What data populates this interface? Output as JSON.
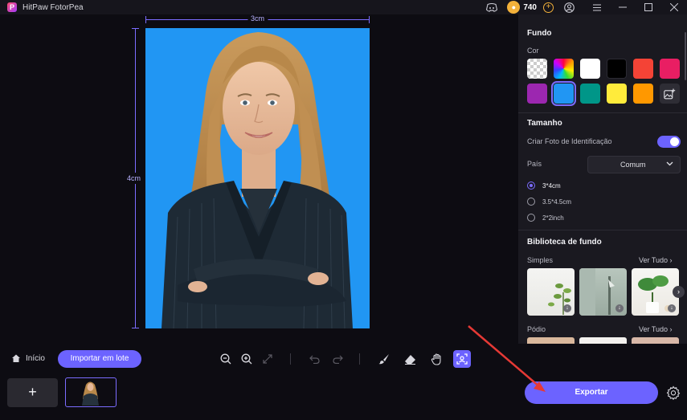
{
  "app": {
    "title": "HitPaw FotorPea",
    "credits": "740"
  },
  "canvas": {
    "width_label": "3cm",
    "height_label": "4cm"
  },
  "panel": {
    "background_title": "Fundo",
    "color_label": "Cor",
    "swatches": [
      {
        "name": "transparent",
        "color": "checker"
      },
      {
        "name": "rainbow",
        "color": "rainbow"
      },
      {
        "name": "white",
        "color": "#ffffff"
      },
      {
        "name": "black",
        "color": "#000000"
      },
      {
        "name": "red",
        "color": "#f44336"
      },
      {
        "name": "pink",
        "color": "#e91e63"
      },
      {
        "name": "purple",
        "color": "#9c27b0"
      },
      {
        "name": "blue",
        "color": "#2196f3",
        "selected": true
      },
      {
        "name": "teal",
        "color": "#009688"
      },
      {
        "name": "yellow",
        "color": "#ffeb3b"
      },
      {
        "name": "orange",
        "color": "#ff9800"
      },
      {
        "name": "custom-image",
        "color": "#2e2d35"
      }
    ],
    "size_title": "Tamanho",
    "id_photo_label": "Criar Foto de Identificação",
    "id_photo_enabled": true,
    "country_label": "País",
    "country_value": "Comum",
    "sizes": [
      {
        "label": "3*4cm",
        "selected": true
      },
      {
        "label": "3.5*4.5cm",
        "selected": false
      },
      {
        "label": "2*2inch",
        "selected": false
      }
    ],
    "library_title": "Biblioteca de fundo",
    "simple_label": "Simples",
    "podium_label": "Pódio",
    "see_all_label": "Ver Tudo"
  },
  "toolbar": {
    "home_label": "Início",
    "batch_label": "Importar em lote"
  },
  "footer": {
    "add_label": "+",
    "export_label": "Exportar"
  },
  "colors": {
    "accent": "#6c63ff",
    "photo_background": "#2196f3",
    "annotation_arrow": "#e53935"
  }
}
